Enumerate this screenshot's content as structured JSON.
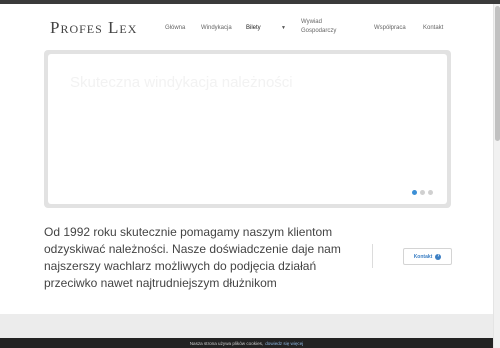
{
  "header": {
    "logo": "Profes Lex",
    "nav": [
      {
        "label": "Główna"
      },
      {
        "label": "Windykacja"
      },
      {
        "label": "Bilety"
      },
      {
        "label": "Wywiad Gospodarczy"
      },
      {
        "label": "Współpraca"
      },
      {
        "label": "Kontakt"
      }
    ],
    "caret_icon": "chevron-down-icon"
  },
  "slider": {
    "title": "Skuteczna windykacja należności",
    "slide_count": 3,
    "active_slide": 1,
    "accent_color": "#3b8fd6"
  },
  "intro": {
    "text": "Od 1992 roku skutecznie pomagamy naszym klientom odzyskiwać należności. Nasze doświadczenie daje nam najszerszy wachlarz możliwych do podjęcia działań przeciwko nawet najtrudniejszym dłużnikom"
  },
  "cta": {
    "label": "Kontakt",
    "icon": "arrow-right-icon"
  },
  "cookie": {
    "text": "Nasza strona używa plików cookies,",
    "link": "dowiedz się więcej"
  }
}
